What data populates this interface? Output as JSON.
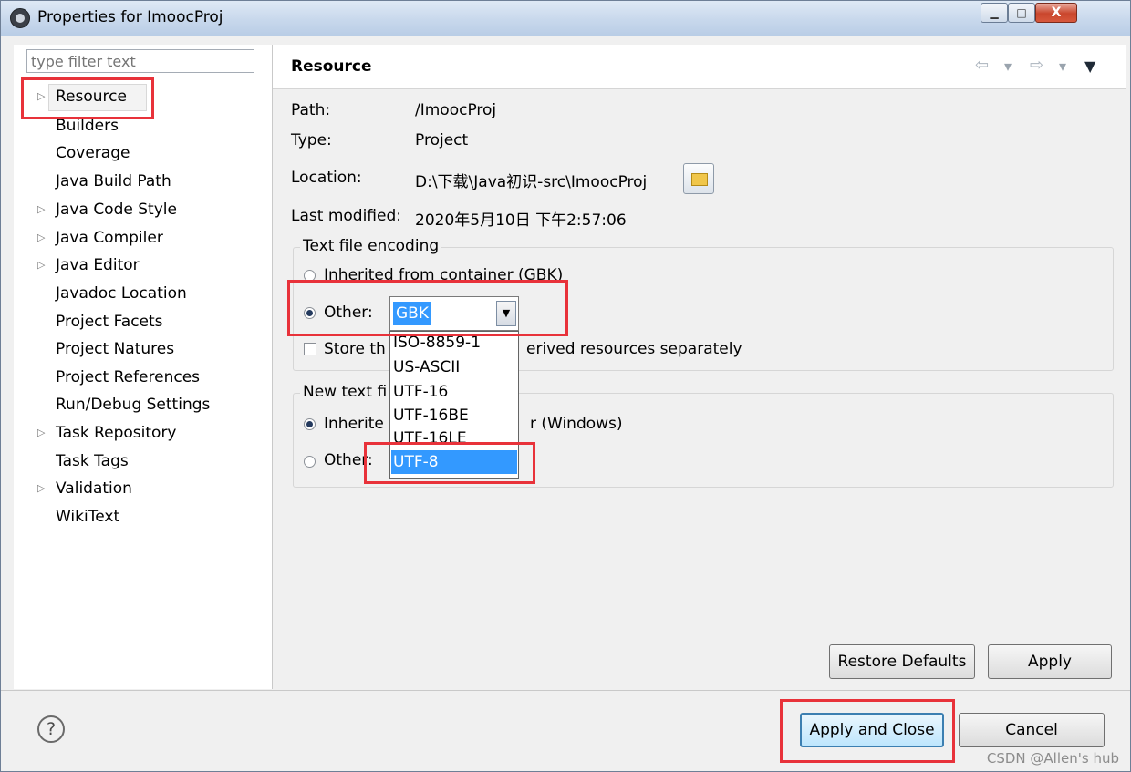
{
  "window": {
    "title": "Properties for ImoocProj",
    "minimize": "▁",
    "maximize": "□",
    "close": "X"
  },
  "filter": {
    "placeholder": "type filter text"
  },
  "tree": {
    "items": [
      {
        "label": "Resource",
        "arrow": "▷"
      },
      {
        "label": "Builders",
        "arrow": ""
      },
      {
        "label": "Coverage",
        "arrow": ""
      },
      {
        "label": "Java Build Path",
        "arrow": ""
      },
      {
        "label": "Java Code Style",
        "arrow": "▷"
      },
      {
        "label": "Java Compiler",
        "arrow": "▷"
      },
      {
        "label": "Java Editor",
        "arrow": "▷"
      },
      {
        "label": "Javadoc Location",
        "arrow": ""
      },
      {
        "label": "Project Facets",
        "arrow": ""
      },
      {
        "label": "Project Natures",
        "arrow": ""
      },
      {
        "label": "Project References",
        "arrow": ""
      },
      {
        "label": "Run/Debug Settings",
        "arrow": ""
      },
      {
        "label": "Task Repository",
        "arrow": "▷"
      },
      {
        "label": "Task Tags",
        "arrow": ""
      },
      {
        "label": "Validation",
        "arrow": "▷"
      },
      {
        "label": "WikiText",
        "arrow": ""
      }
    ]
  },
  "page": {
    "title": "Resource",
    "nav": {
      "back": "⇦",
      "forward": "⇨",
      "menu": "▾",
      "view_menu": "▼"
    },
    "path_label": "Path:",
    "path_value": "/ImoocProj",
    "type_label": "Type:",
    "type_value": "Project",
    "location_label": "Location:",
    "location_value": "D:\\下载\\Java初识-src\\ImoocProj",
    "modified_label": "Last modified:",
    "modified_value": "2020年5月10日 下午2:57:06"
  },
  "encoding": {
    "group_title": "Text file encoding",
    "inherited_label": "Inherited from container (GBK)",
    "other_label": "Other:",
    "combo_value": "GBK",
    "combo_arrow": "▼",
    "store_label_a": "Store th",
    "store_label_b": "erived resources separately",
    "options": [
      "ISO-8859-1",
      "US-ASCII",
      "UTF-16",
      "UTF-16BE",
      "UTF-16LE",
      "UTF-8"
    ]
  },
  "delimiter": {
    "group_title": "New text fi",
    "inherited_label_a": "Inherite",
    "inherited_label_b": "r (Windows)",
    "other_label": "Other:"
  },
  "buttons": {
    "restore_defaults": "Restore Defaults",
    "apply": "Apply",
    "apply_and_close": "Apply and Close",
    "cancel": "Cancel",
    "help": "?"
  },
  "watermark": "CSDN @Allen's hub",
  "colors": {
    "highlight": "#e8323a",
    "selection": "#3399ff"
  }
}
